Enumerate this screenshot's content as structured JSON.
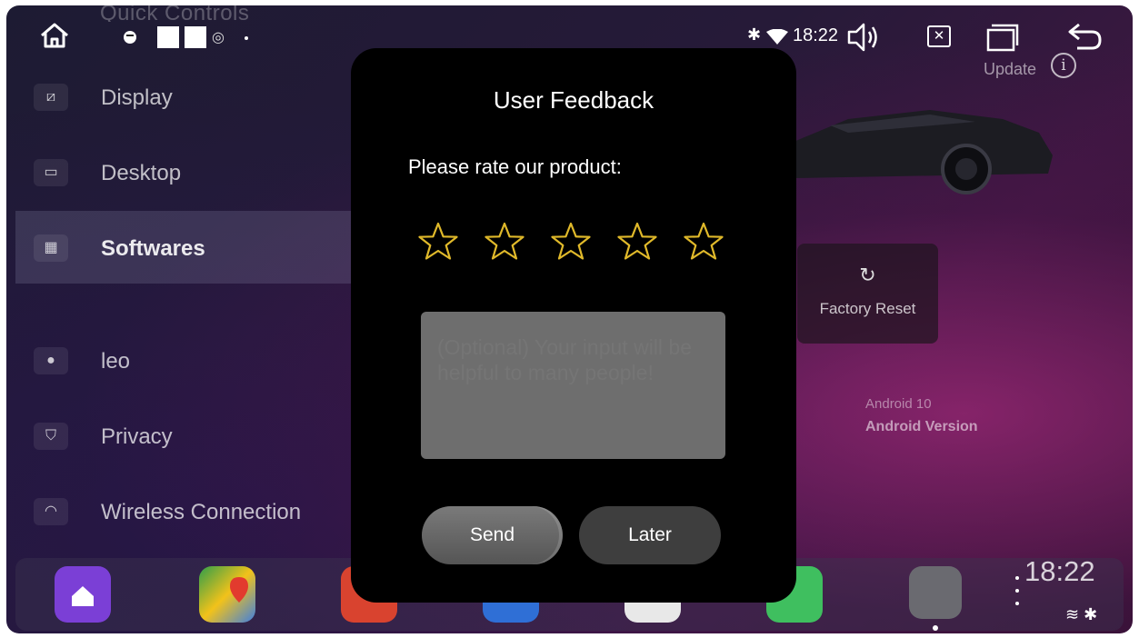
{
  "status_bar": {
    "quick_controls_label": "Quick Controls",
    "time": "18:22",
    "update_label": "Update",
    "info_glyph": "i",
    "close_glyph": "✕",
    "bluetooth_glyph": "✱",
    "pin_glyph": "◎",
    "icons": [
      "home-icon",
      "spotify-icon",
      "location-icon",
      "bluetooth-icon",
      "wifi-icon",
      "volume-icon",
      "close-screen-icon",
      "recent-apps-icon",
      "back-icon"
    ]
  },
  "sidebar": {
    "items": [
      {
        "label": "Display",
        "icon": "display-icon",
        "glyph": "⧄"
      },
      {
        "label": "Desktop",
        "icon": "desktop-icon",
        "glyph": "▭"
      },
      {
        "label": "Softwares",
        "icon": "apps-grid-icon",
        "glyph": "▦",
        "active": true
      },
      {
        "label": "leo",
        "icon": "user-icon",
        "glyph": "●"
      },
      {
        "label": "Privacy",
        "icon": "shield-icon",
        "glyph": "⛉"
      },
      {
        "label": "Wireless Connection",
        "icon": "wifi-icon",
        "glyph": "◠"
      }
    ]
  },
  "main": {
    "factory_reset_label": "Factory Reset",
    "factory_reset_glyph": "↻",
    "android_version_value": "Android 10",
    "android_version_label": "Android Version"
  },
  "dock": {
    "time": "18:22",
    "status_glyph": "≋ ✱",
    "apps": [
      "home-app",
      "maps-app",
      "music-app",
      "calendar-app",
      "chrome-app",
      "phone-app",
      "car-settings-app"
    ],
    "app_colors": [
      "#7b3fd6",
      "#2f9e4a",
      "#d9432f",
      "#2f6fd6",
      "#e8e8e8",
      "#3fbf5f",
      "#6a6a70"
    ]
  },
  "modal": {
    "title": "User Feedback",
    "prompt": "Please rate our product:",
    "rating": 0,
    "rating_max": 5,
    "star_color": "#e0b92a",
    "feedback_placeholder": "(Optional) Your input will be helpful to many people!",
    "send_label": "Send",
    "later_label": "Later"
  }
}
